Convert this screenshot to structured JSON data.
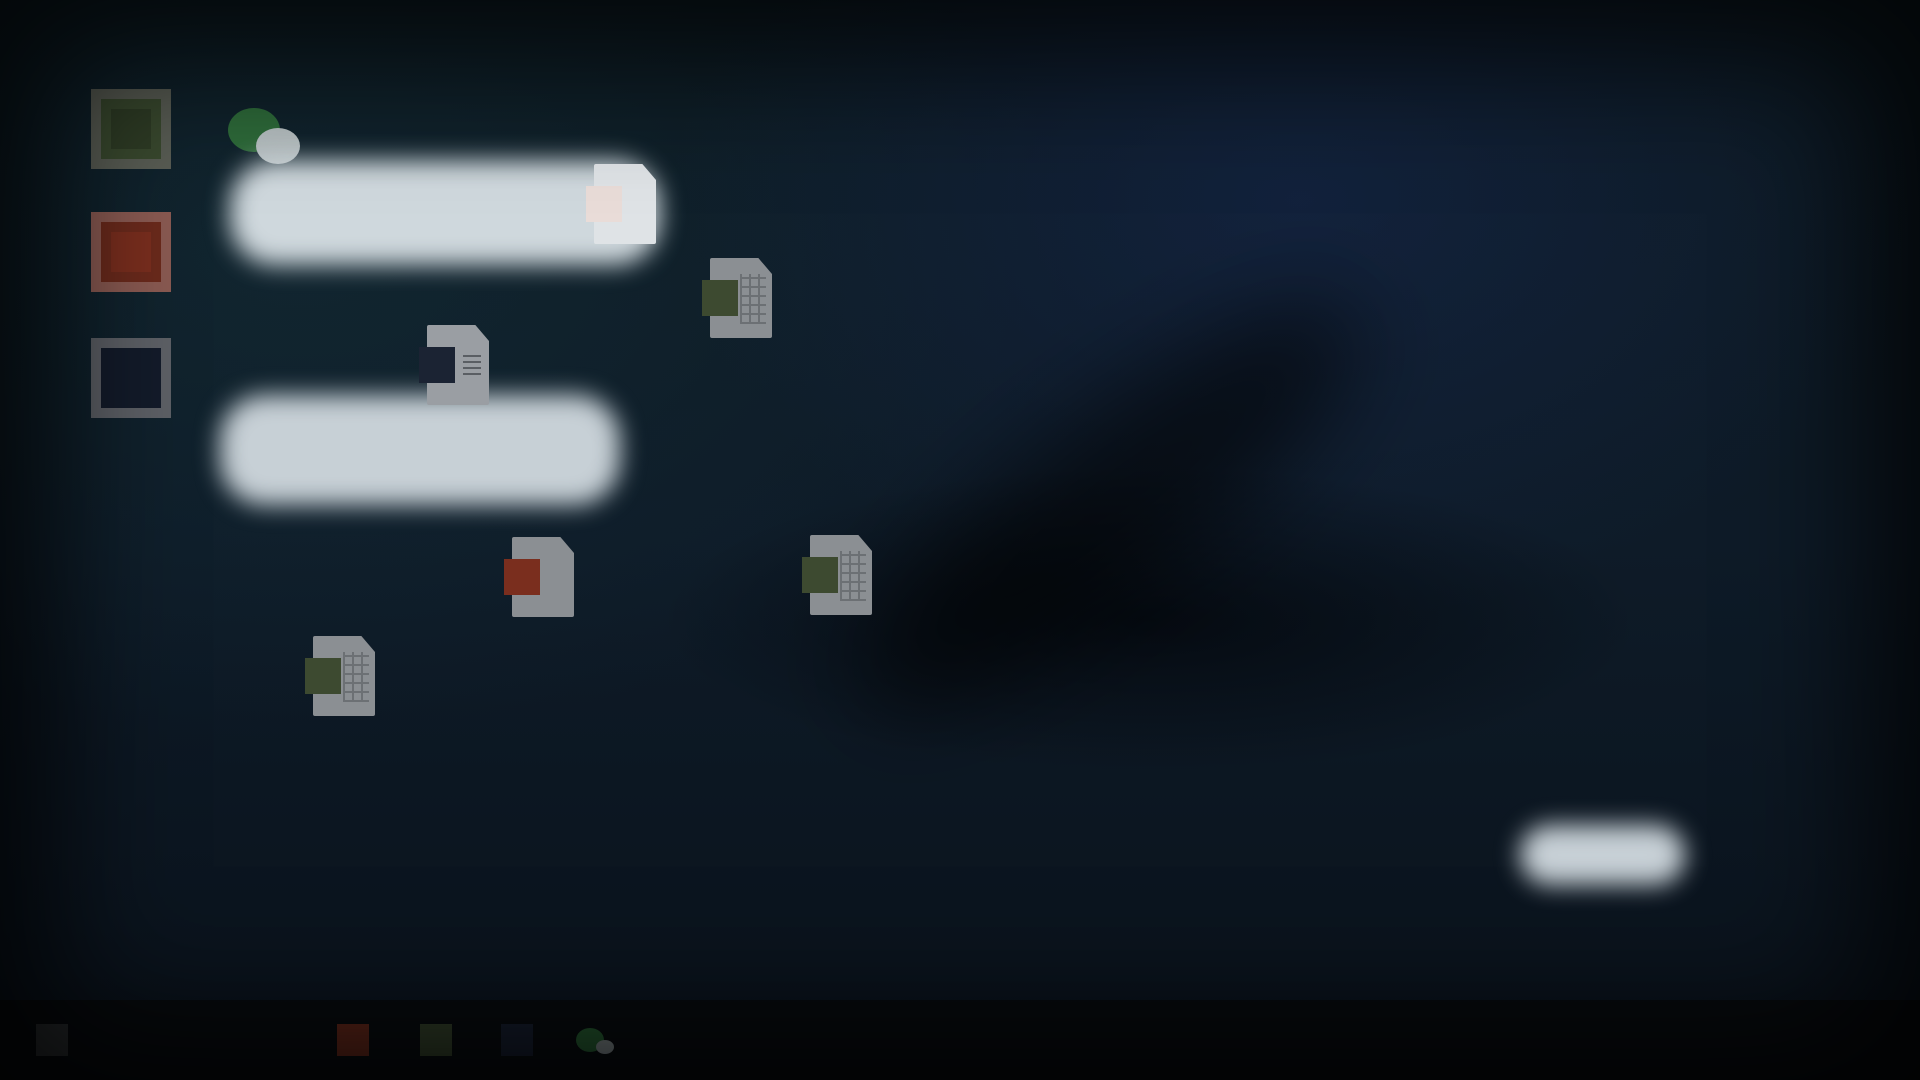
{
  "colors": {
    "background": "#0e1b28",
    "label_blur": "#c7d0d6",
    "green_app": "#3a4a2f",
    "red_app": "#7a2e1e",
    "navy_app": "#131b2a",
    "doc_gray": "#8b8f93",
    "chat_green": "#2e6b3a"
  },
  "desktop": {
    "app_icons": [
      {
        "icon": "spreadsheet-app-icon",
        "color": "green"
      },
      {
        "icon": "presentation-app-icon",
        "color": "red"
      },
      {
        "icon": "writer-app-icon",
        "color": "navy"
      }
    ],
    "chat_icon": "chat-icon",
    "files": [
      {
        "icon": "presentation-file-icon",
        "badge": "light"
      },
      {
        "icon": "spreadsheet-file-icon",
        "badge": "green"
      },
      {
        "icon": "text-document-file-icon",
        "badge": "navy"
      },
      {
        "icon": "presentation-file-icon",
        "badge": "red"
      },
      {
        "icon": "spreadsheet-file-icon",
        "badge": "green"
      },
      {
        "icon": "spreadsheet-file-icon",
        "badge": "green"
      }
    ]
  },
  "taskbar": {
    "items": [
      "menu-icon",
      "presentation-icon",
      "spreadsheet-icon",
      "writer-icon",
      "chat-icon"
    ]
  }
}
